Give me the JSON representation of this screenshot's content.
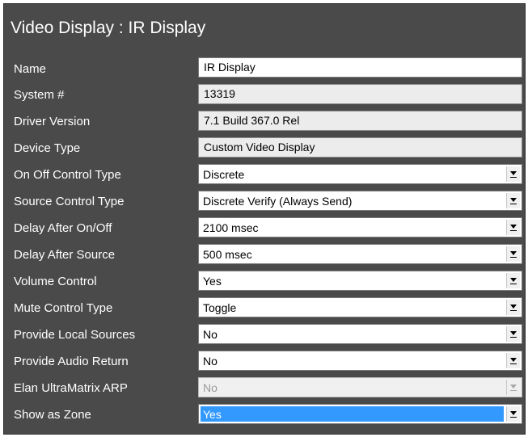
{
  "panel": {
    "title": "Video Display : IR Display"
  },
  "properties": [
    {
      "label": "Name",
      "value": "IR Display",
      "kind": "text"
    },
    {
      "label": "System #",
      "value": "13319",
      "kind": "readonly"
    },
    {
      "label": "Driver Version",
      "value": "7.1 Build 367.0 Rel",
      "kind": "readonly"
    },
    {
      "label": "Device Type",
      "value": "Custom Video Display",
      "kind": "readonly"
    },
    {
      "label": "On Off Control Type",
      "value": "Discrete",
      "kind": "select"
    },
    {
      "label": "Source Control Type",
      "value": "Discrete Verify (Always Send)",
      "kind": "select"
    },
    {
      "label": "Delay After On/Off",
      "value": "2100 msec",
      "kind": "select"
    },
    {
      "label": "Delay After Source",
      "value": "500 msec",
      "kind": "select"
    },
    {
      "label": "Volume Control",
      "value": "Yes",
      "kind": "select"
    },
    {
      "label": "Mute Control Type",
      "value": "Toggle",
      "kind": "select"
    },
    {
      "label": "Provide Local Sources",
      "value": "No",
      "kind": "select"
    },
    {
      "label": "Provide Audio Return",
      "value": "No",
      "kind": "select"
    },
    {
      "label": "Elan UltraMatrix ARP",
      "value": "No",
      "kind": "select-disabled"
    },
    {
      "label": "Show as Zone",
      "value": "Yes",
      "kind": "select-highlight"
    }
  ],
  "icons": {
    "dropdown": "chevron-down-icon"
  },
  "colors": {
    "panel_background": "#4a4a4a",
    "selection_highlight": "#3399ff",
    "readonly_field": "#ececec",
    "disabled_text": "#9a9a9a"
  }
}
